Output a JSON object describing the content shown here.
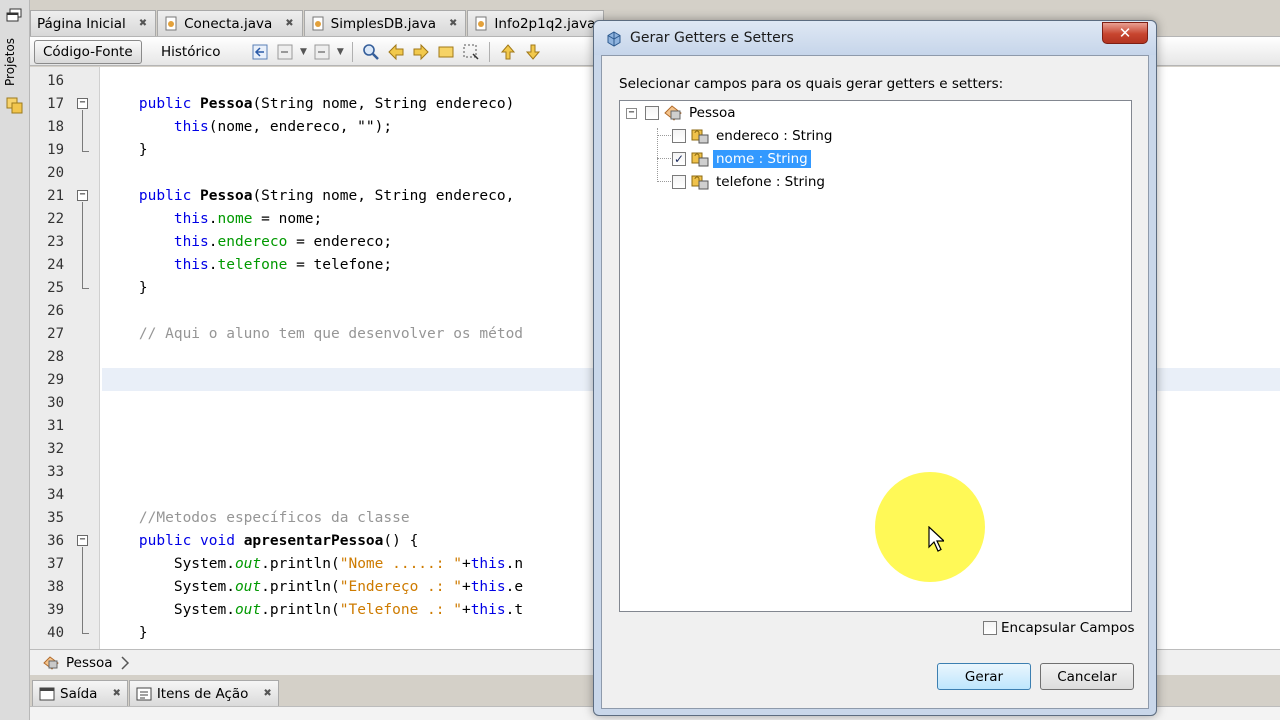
{
  "left_strip": {
    "projects_label": "Projetos"
  },
  "editor_tabs": [
    {
      "label": "Página Inicial"
    },
    {
      "label": "Conecta.java"
    },
    {
      "label": "SimplesDB.java"
    },
    {
      "label": "Info2p1q2.java"
    }
  ],
  "toolbar": {
    "source_label": "Código-Fonte",
    "history_label": "Histórico"
  },
  "code": {
    "lines": [
      {
        "num": "16"
      },
      {
        "num": "17"
      },
      {
        "num": "18"
      },
      {
        "num": "19"
      },
      {
        "num": "20"
      },
      {
        "num": "21"
      },
      {
        "num": "22"
      },
      {
        "num": "23"
      },
      {
        "num": "24"
      },
      {
        "num": "25"
      },
      {
        "num": "26"
      },
      {
        "num": "27"
      },
      {
        "num": "28"
      },
      {
        "num": "29"
      },
      {
        "num": "30"
      },
      {
        "num": "31"
      },
      {
        "num": "32"
      },
      {
        "num": "33"
      },
      {
        "num": "34"
      },
      {
        "num": "35"
      },
      {
        "num": "36"
      },
      {
        "num": "37"
      },
      {
        "num": "38"
      },
      {
        "num": "39"
      },
      {
        "num": "40"
      }
    ],
    "tokens": {
      "public": "public",
      "void": "void",
      "this": "this",
      "pessoa_name": "Pessoa",
      "ctor1_params": "(String nome, String endereco)",
      "ctor2_params": "(String nome, String endereco,",
      "this_call_args": "(nome, endereco, \"\");",
      "nome_field": "nome",
      "endereco_field": "endereco",
      "telefone_field": "telefone",
      "assign_nome": " = nome;",
      "assign_endereco": " = endereco;",
      "assign_telefone": " = telefone;",
      "close_brace": "}",
      "comment_27": "// Aqui o aluno tem que desenvolver os métod",
      "comment_35": "//Metodos específicos da classe",
      "apresentar_name": "apresentarPessoa",
      "apresentar_rest": "() {",
      "system": "System.",
      "out": "out",
      "println_open": ".println(",
      "str_nome": "\"Nome .....: \"",
      "str_endereco": "\"Endereço .: \"",
      "str_telefone": "\"Telefone .: \"",
      "plus": "+",
      "tail_37": ".n",
      "tail_38": ".e",
      "tail_39": ".t",
      "dot": "."
    }
  },
  "nav_bar": {
    "class_label": "Pessoa"
  },
  "bottom_tabs": [
    {
      "label": "Saída"
    },
    {
      "label": "Itens de Ação"
    }
  ],
  "dialog": {
    "title": "Gerar Getters e Setters",
    "close_label": "✕",
    "instruction": "Selecionar campos para os quais gerar getters e setters:",
    "tree": {
      "root": {
        "label": "Pessoa",
        "checked": false
      },
      "fields": [
        {
          "label": "endereco : String",
          "checked": false,
          "selected": false
        },
        {
          "label": "nome : String",
          "checked": true,
          "selected": true
        },
        {
          "label": "telefone : String",
          "checked": false,
          "selected": false
        }
      ]
    },
    "encapsular_label": "Encapsular Campos",
    "gerar_label": "Gerar",
    "cancelar_label": "Cancelar"
  }
}
